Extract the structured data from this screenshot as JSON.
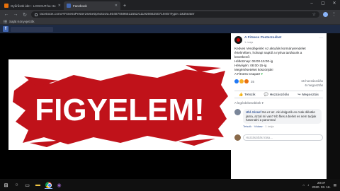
{
  "browser": {
    "tabs": [
      {
        "title": "Gyűrűsök ide! - LOGOUT.hu Ho…",
        "favicon_color": "#e8710a",
        "active": false
      },
      {
        "title": "Facebook",
        "favicon_color": "#4267b2",
        "active": true
      }
    ],
    "url": "facebook.com/AFitnessPesterzsebet/photos/a.804870596511552/1119266625071946/?type=3&theater",
    "bookmarks_label": "Saját Könyvjelzők"
  },
  "photo": {
    "text": "FIGYELEM!",
    "brush_color": "#c0121a"
  },
  "post": {
    "page_name": "A Fitness Pesterzsébet",
    "time": "1 órája",
    "text_lines": [
      "Kedves Vendégeink! Az aktuális kormányrendelet",
      "értelmében, holnapi naptól a nyitva tartásunk a",
      "következő:",
      "Hétköznap: 06:00-15:00-ig",
      "Hétvégén: 08:00-15-ig",
      "Megértéseteket köszönjük!",
      "A Fitness Csapat!"
    ],
    "reaction_count": "35",
    "comments_count": "16 hozzászólás",
    "shares_count": "6 megosztás",
    "actions": {
      "like": "Tetszik",
      "comment": "Hozzászólás",
      "share": "Megosztás"
    },
    "sort_label": "A legérdekesebbek",
    "comment": {
      "author": "Uhl József",
      "text": "Na ez az. Aki dolgozik es csak délután jarna, azzal mi van? Kb fites a berlet es nem tudjuk hasznalni a paromnal",
      "like": "Tetszik",
      "reply": "Válasz",
      "time": "1 órája"
    },
    "write_placeholder": "Hozzászólás írása…"
  },
  "taskbar": {
    "time": "20:07",
    "date": "2020. 03. 16."
  }
}
